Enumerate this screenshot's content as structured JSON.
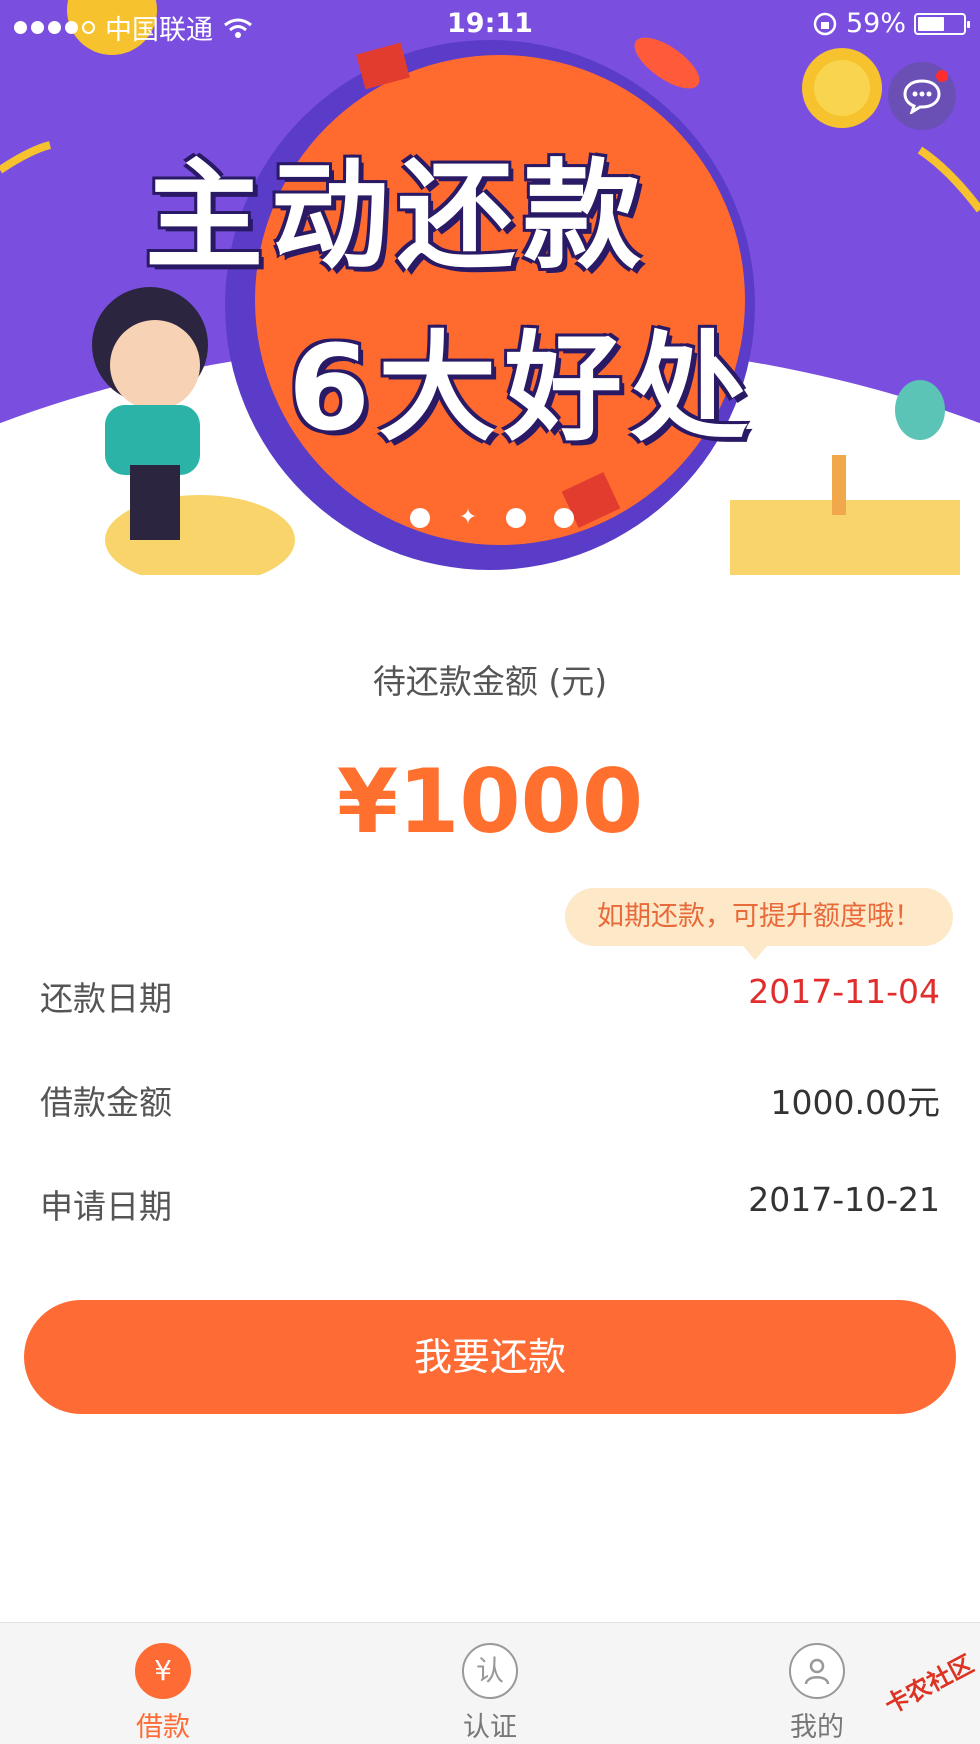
{
  "status_bar": {
    "carrier": "中国联通",
    "time": "19:11",
    "battery": "59%",
    "battery_level": 0.59
  },
  "banner": {
    "title_line1": "主动还款",
    "title_line2": "6大好处"
  },
  "main": {
    "amount_label": "待还款金额 (元)",
    "amount_value": "¥1000",
    "tooltip": "如期还款，可提升额度哦！",
    "rows": [
      {
        "label": "还款日期",
        "value": "2017-11-04"
      },
      {
        "label": "借款金额",
        "value": "1000.00元"
      },
      {
        "label": "申请日期",
        "value": "2017-10-21"
      }
    ],
    "pay_button": "我要还款"
  },
  "tabs": [
    {
      "label": "借款",
      "icon": "¥"
    },
    {
      "label": "认证",
      "icon": "认"
    },
    {
      "label": "我的",
      "icon": "person-icon"
    }
  ],
  "watermark": "卡农社区",
  "colors": {
    "accent": "#ff6b35",
    "banner_bg": "#7a4fe0",
    "due_date": "#e22d2d",
    "amount": "#ff6f2e"
  }
}
